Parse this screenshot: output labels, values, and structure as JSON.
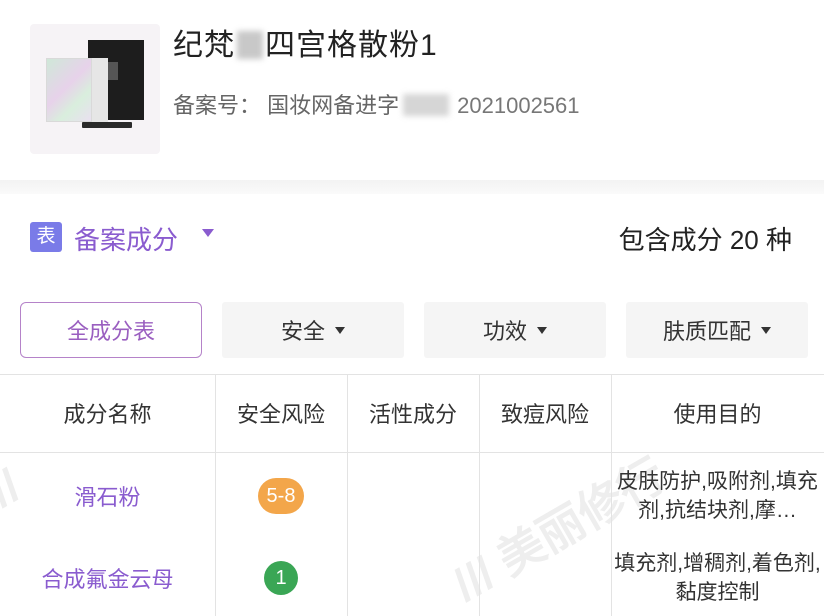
{
  "product": {
    "title_prefix": "纪梵",
    "title_suffix": "四宫格散粉1",
    "reg_label": "备案号：",
    "reg_prefix": "国妆网备进字",
    "reg_number": "2021002561"
  },
  "section": {
    "icon_text": "表",
    "title": "备案成分",
    "count_text": "包含成分 20 种"
  },
  "filters": [
    {
      "label": "全成分表",
      "active": true
    },
    {
      "label": "安全",
      "active": false
    },
    {
      "label": "功效",
      "active": false
    },
    {
      "label": "肤质匹配",
      "active": false
    }
  ],
  "table": {
    "headers": [
      "成分名称",
      "安全风险",
      "活性成分",
      "致痘风险",
      "使用目的"
    ],
    "rows": [
      {
        "name": "滑石粉",
        "risk": "5-8",
        "risk_color": "#f3a64a",
        "active": "",
        "acne": "",
        "purpose": "皮肤防护,吸附剂,填充剂,抗结块剂,摩…"
      },
      {
        "name": "合成氟金云母",
        "risk": "1",
        "risk_color": "#3aa655",
        "active": "",
        "acne": "",
        "purpose": "填充剂,增稠剂,着色剂,黏度控制"
      }
    ]
  },
  "colors": {
    "accent": "#8a5ccf",
    "icon_bg": "#7a7be8"
  }
}
